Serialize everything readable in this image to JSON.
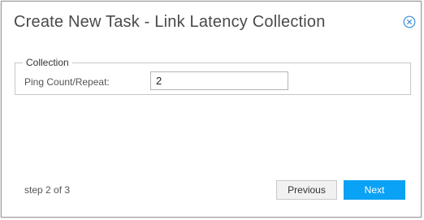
{
  "dialog": {
    "title": "Create New Task - Link Latency Collection",
    "close_icon": "close-circle-icon"
  },
  "collection": {
    "legend": "Collection",
    "ping_label": "Ping Count/Repeat:",
    "ping_value": "2"
  },
  "footer": {
    "step_text": "step 2 of 3",
    "previous_label": "Previous",
    "next_label": "Next"
  },
  "colors": {
    "accent": "#0aa2f5",
    "close_icon": "#3d8fd6"
  }
}
